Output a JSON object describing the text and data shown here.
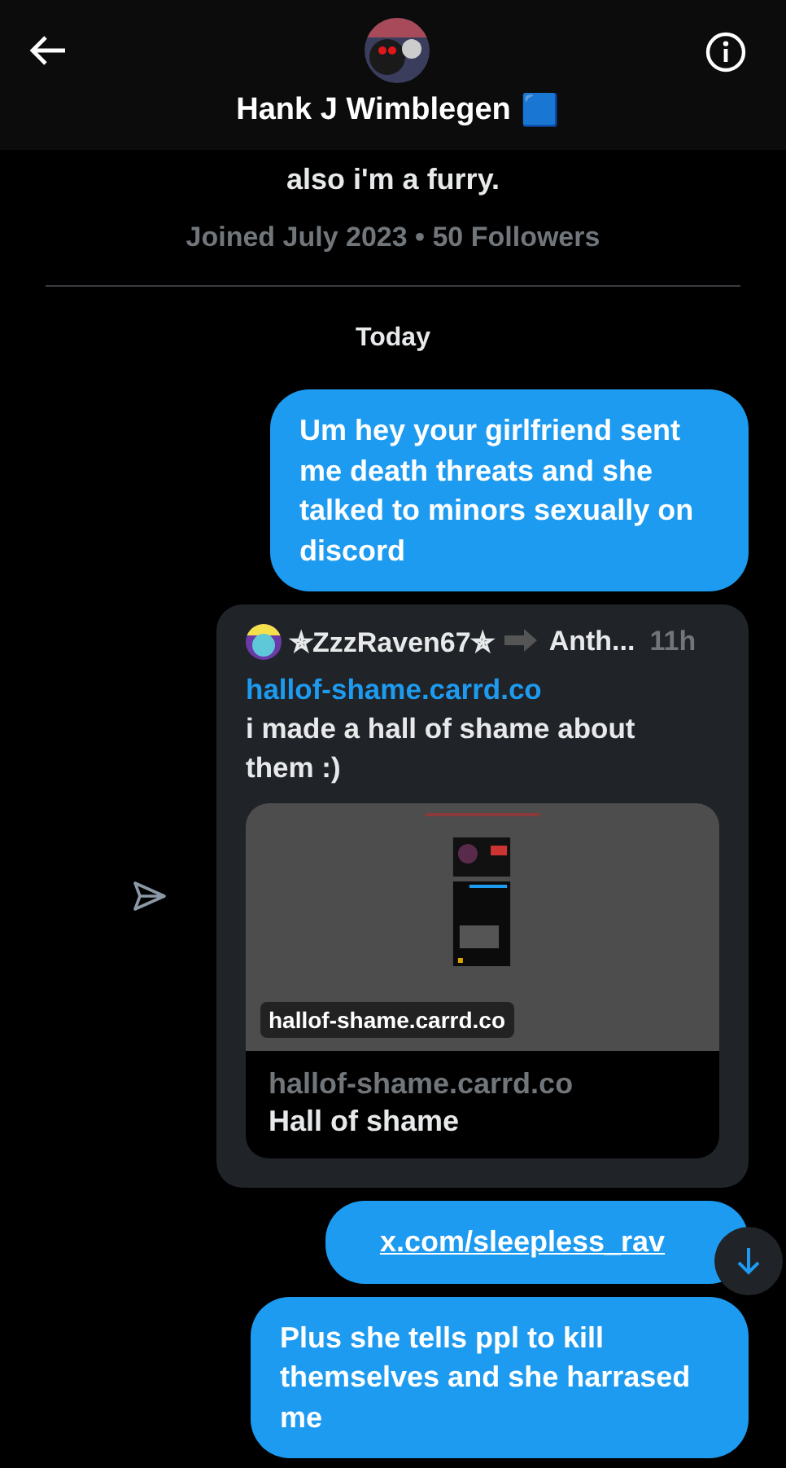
{
  "header": {
    "name": "Hank J Wimblegen",
    "badge": "🟦"
  },
  "profile": {
    "bio": "also i'm a furry.",
    "meta": "Joined July 2023 • 50 Followers"
  },
  "date_divider": "Today",
  "messages": [
    {
      "kind": "text",
      "text": "Um hey your girlfriend sent me death threats and she talked to minors sexually on discord"
    },
    {
      "kind": "quote",
      "author": "✯ZzzRaven67✯",
      "author_more": "Anth...",
      "time": "11h",
      "link": "hallof-shame.carrd.co",
      "text": "i made a hall of shame about them :)",
      "card": {
        "kind": "picture",
        "overlay_label": "hallof-shame.carrd.co",
        "domain": "hallof-shame.carrd.co",
        "title": "Hall of shame"
      }
    },
    {
      "kind": "link",
      "text": "x.com/sleepless_rav"
    },
    {
      "kind": "text",
      "text": "Plus she tells ppl to kill themselves and she harrased me"
    }
  ]
}
